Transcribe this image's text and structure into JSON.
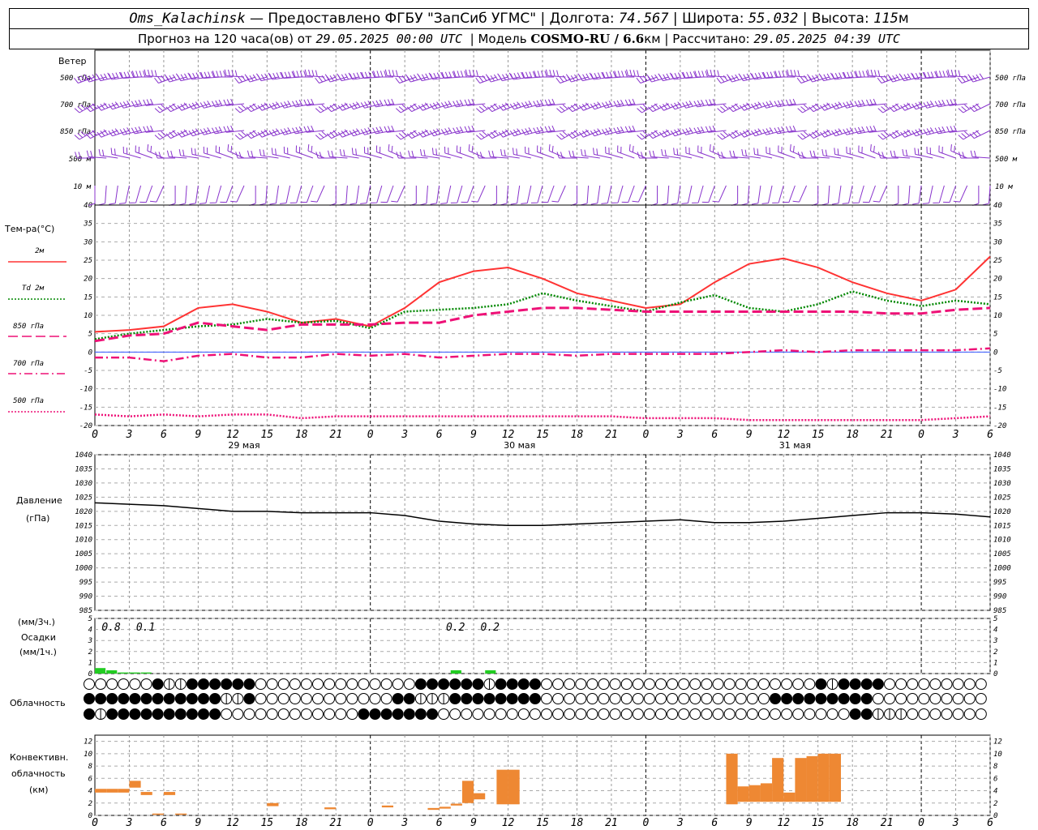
{
  "header": {
    "station": "Oms_Kalachinsk",
    "provided": "— Предоставлено ФГБУ \"ЗапСиб УГМС\" |",
    "lon_label": "Долгота:",
    "lon": "74.567",
    "lat_label": "| Широта:",
    "lat": "55.032",
    "alt_label": "| Высота:",
    "alt": "115",
    "alt_unit": "м",
    "forecast_label": "Прогноз на 120 часа(ов) от",
    "forecast_start": "29.05.2025 00:00 UTC",
    "model_label": "| Модель",
    "model": "COSMO-RU / 6.6",
    "model_unit": "км",
    "calc_label": "| Рассчитано:",
    "calc_time": "29.05.2025 04:39 UTC"
  },
  "wind_panel": {
    "title": "Ветер",
    "levels": [
      "500 гПа",
      "700 гПа",
      "850 гПа",
      "500 м",
      "10  м"
    ]
  },
  "temp_panel": {
    "title": "Тем-ра(°C)",
    "legend": [
      {
        "label": "2м",
        "color": "#ff3333",
        "style": "solid"
      },
      {
        "label": "Td  2м",
        "color": "#008800",
        "style": "dotted"
      },
      {
        "label": "850 гПа",
        "color": "#ee1177",
        "style": "dashed"
      },
      {
        "label": "700 гПа",
        "color": "#ee1177",
        "style": "dashdot"
      },
      {
        "label": "500 гПа",
        "color": "#ee1177",
        "style": "dotted"
      }
    ]
  },
  "pressure_panel": {
    "title": "Давление",
    "unit": "(гПа)"
  },
  "precip_panel": {
    "unit3": "(мм/3ч.)",
    "title": "Осадки",
    "unit1": "(мм/1ч.)",
    "labels": [
      {
        "hour": 1,
        "text": "0.8"
      },
      {
        "hour": 4,
        "text": "0.1"
      },
      {
        "hour": 31,
        "text": "0.2"
      },
      {
        "hour": 34,
        "text": "0.2"
      }
    ]
  },
  "cloud_panel": {
    "title": "Облачность"
  },
  "convective_panel": {
    "title": [
      "Конвективн.",
      "облачность",
      "(км)"
    ]
  },
  "x_axis": {
    "ticks": [
      "0",
      "3",
      "6",
      "9",
      "12",
      "15",
      "18",
      "21",
      "0",
      "3",
      "6",
      "9",
      "12",
      "15",
      "18",
      "21",
      "0",
      "3",
      "6",
      "9",
      "12",
      "15",
      "18",
      "21",
      "0",
      "3",
      "6"
    ],
    "dates": [
      {
        "text": "29 мая",
        "hour": 13
      },
      {
        "text": "30 мая",
        "hour": 37
      },
      {
        "text": "31 мая",
        "hour": 61
      }
    ]
  },
  "chart_data": [
    {
      "type": "line",
      "name": "temperature",
      "x_hours": [
        0,
        3,
        6,
        9,
        12,
        15,
        18,
        21,
        24,
        27,
        30,
        33,
        36,
        39,
        42,
        45,
        48,
        51,
        54,
        57,
        60,
        63,
        66,
        69,
        72,
        75,
        78
      ],
      "ylim": [
        -20,
        40
      ],
      "yticks": [
        -20,
        -15,
        -10,
        -5,
        0,
        5,
        10,
        15,
        20,
        25,
        30,
        35,
        40
      ],
      "series": [
        {
          "name": "2м",
          "color": "#ff3333",
          "values": [
            5.5,
            6,
            7,
            12,
            13,
            11,
            8,
            9,
            7,
            12,
            19,
            22,
            23,
            20,
            16,
            14,
            12,
            13,
            19,
            24,
            25.5,
            23,
            19,
            16,
            14,
            17,
            26
          ]
        },
        {
          "name": "Td  2м",
          "color": "#008800",
          "values": [
            3.5,
            5,
            6,
            7,
            7.5,
            9,
            8,
            8.5,
            6.5,
            11,
            11.5,
            12,
            13,
            16,
            14,
            12.5,
            11,
            13.5,
            15.5,
            12,
            11,
            13,
            16.5,
            14,
            12.5,
            14,
            13
          ]
        },
        {
          "name": "850 гПа",
          "color": "#ee1177",
          "values": [
            3,
            4.5,
            5,
            8,
            7,
            6,
            7.5,
            7.5,
            7.5,
            8,
            8,
            10,
            11,
            12,
            12,
            11.5,
            11,
            11,
            11,
            11,
            11,
            11,
            11,
            10.5,
            10.5,
            11.5,
            12
          ]
        },
        {
          "name": "700 гПа",
          "color": "#ee1177",
          "values": [
            -1.5,
            -1.5,
            -2.5,
            -1,
            -0.5,
            -1.5,
            -1.5,
            -0.5,
            -1,
            -0.5,
            -1.5,
            -1,
            -0.5,
            -0.5,
            -1,
            -0.5,
            -0.5,
            -0.5,
            -0.5,
            0,
            0.5,
            0,
            0.5,
            0.5,
            0.5,
            0.5,
            1
          ]
        },
        {
          "name": "500 гПа",
          "color": "#ee1177",
          "values": [
            -17,
            -17.5,
            -17,
            -17.5,
            -17,
            -17,
            -18,
            -17.5,
            -17.5,
            -17.5,
            -17.5,
            -17.5,
            -17.5,
            -17.5,
            -17.5,
            -17.5,
            -18,
            -18,
            -18,
            -18.5,
            -18.5,
            -18.5,
            -18.5,
            -18.5,
            -18.5,
            -18,
            -17.5
          ]
        }
      ]
    },
    {
      "type": "line",
      "name": "pressure",
      "ylim": [
        985,
        1040
      ],
      "yticks": [
        985,
        990,
        995,
        1000,
        1005,
        1010,
        1015,
        1020,
        1025,
        1030,
        1035,
        1040
      ],
      "x_hours": [
        0,
        3,
        6,
        9,
        12,
        15,
        18,
        21,
        24,
        27,
        30,
        33,
        36,
        39,
        42,
        45,
        48,
        51,
        54,
        57,
        60,
        63,
        66,
        69,
        72,
        75,
        78
      ],
      "values": [
        1023,
        1022.5,
        1022,
        1021,
        1020,
        1020,
        1019.5,
        1019.5,
        1019.5,
        1018.5,
        1016.5,
        1015.5,
        1015,
        1015,
        1015.5,
        1016,
        1016.5,
        1017,
        1016,
        1016,
        1016.5,
        1017.5,
        1018.5,
        1019.5,
        1019.5,
        1019,
        1018
      ]
    },
    {
      "type": "bar",
      "name": "precipitation_1h",
      "ylim": [
        0,
        5
      ],
      "yticks": [
        0,
        1,
        2,
        3,
        4,
        5
      ],
      "x_hours": [
        0,
        1,
        2,
        3,
        4
      ],
      "values": [
        0.5,
        0.3,
        0.1,
        0.1,
        0.1
      ],
      "extra": [
        {
          "x": 31,
          "value": 0.3
        },
        {
          "x": 34,
          "value": 0.3
        }
      ],
      "color": "#22cc22"
    },
    {
      "type": "bar",
      "name": "convective_cloud",
      "ylim": [
        0,
        13
      ],
      "yticks": [
        0,
        2,
        4,
        6,
        8,
        10,
        12
      ],
      "color": "#ee8833",
      "bars": [
        {
          "x": 0,
          "base": 3.7,
          "top": 4.3
        },
        {
          "x": 1,
          "base": 3.7,
          "top": 4.3
        },
        {
          "x": 2,
          "base": 3.7,
          "top": 4.3
        },
        {
          "x": 3,
          "base": 4.5,
          "top": 5.6
        },
        {
          "x": 4,
          "base": 3.3,
          "top": 3.8
        },
        {
          "x": 5,
          "base": 0.1,
          "top": 0.3
        },
        {
          "x": 6,
          "base": 3.3,
          "top": 3.8
        },
        {
          "x": 7,
          "base": 0.1,
          "top": 0.3
        },
        {
          "x": 15,
          "base": 1.5,
          "top": 2.0
        },
        {
          "x": 20,
          "base": 1.0,
          "top": 1.3
        },
        {
          "x": 25,
          "base": 1.3,
          "top": 1.6
        },
        {
          "x": 29,
          "base": 0.9,
          "top": 1.2
        },
        {
          "x": 30,
          "base": 1.1,
          "top": 1.4
        },
        {
          "x": 31,
          "base": 1.6,
          "top": 1.9
        },
        {
          "x": 32,
          "base": 2.0,
          "top": 5.6
        },
        {
          "x": 33,
          "base": 2.6,
          "top": 3.6
        },
        {
          "x": 35,
          "base": 1.8,
          "top": 7.4
        },
        {
          "x": 36,
          "base": 1.8,
          "top": 7.4
        },
        {
          "x": 55,
          "base": 1.8,
          "top": 10.0
        },
        {
          "x": 56,
          "base": 2.2,
          "top": 4.7
        },
        {
          "x": 57,
          "base": 2.2,
          "top": 4.9
        },
        {
          "x": 58,
          "base": 2.2,
          "top": 5.2
        },
        {
          "x": 59,
          "base": 2.2,
          "top": 9.3
        },
        {
          "x": 60,
          "base": 2.2,
          "top": 3.7
        },
        {
          "x": 61,
          "base": 2.2,
          "top": 9.3
        },
        {
          "x": 62,
          "base": 2.2,
          "top": 9.6
        },
        {
          "x": 63,
          "base": 2.2,
          "top": 10.0
        },
        {
          "x": 64,
          "base": 2.2,
          "top": 10.0
        }
      ]
    },
    {
      "type": "table",
      "name": "cloud_cover",
      "rows": [
        "000000711777777000000000000007777771777700000000000000000000000071777700000000000000",
        "777777777777117000000000000771117777777700000000000000000000777777777000000000000000",
        "717777777777000000000000777777700000000000000000000000000000000000077111000000000000"
      ]
    },
    {
      "type": "wind_barbs",
      "name": "wind",
      "levels": [
        "500 гПа",
        "700 гПа",
        "850 гПа",
        "500 м",
        "10  м"
      ],
      "direction_deg": [
        250,
        240,
        240,
        270,
        180
      ],
      "speed_kt": [
        35,
        30,
        25,
        15,
        10
      ]
    }
  ]
}
